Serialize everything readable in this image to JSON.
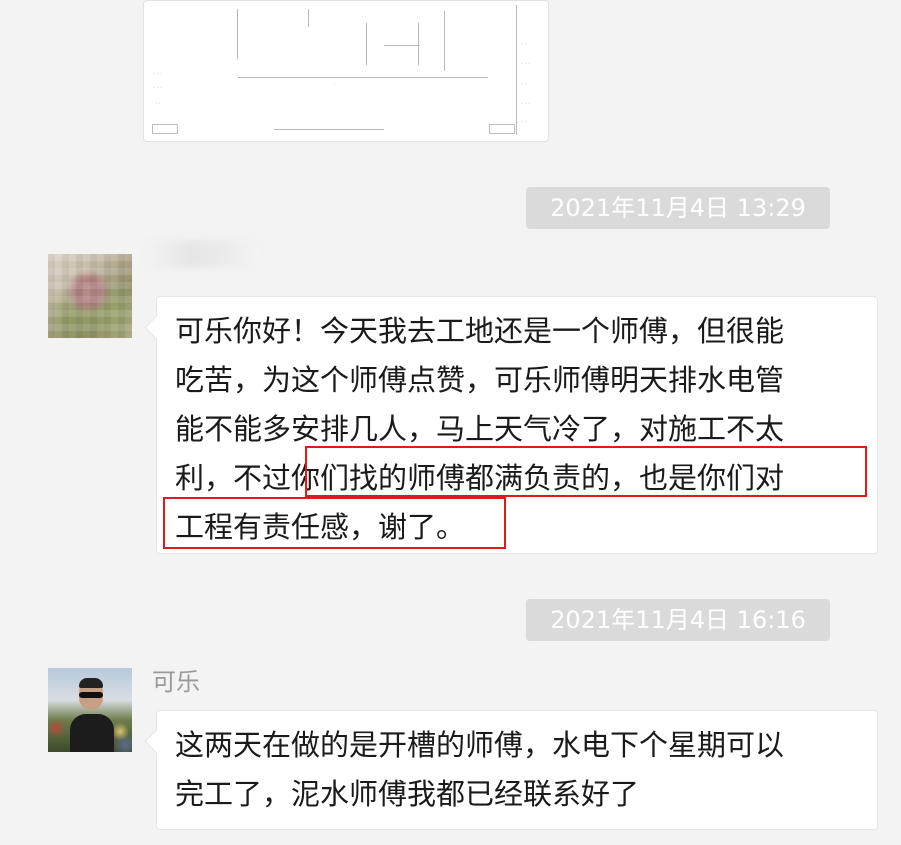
{
  "messages": [
    {
      "timestamp": "2021年11月4日 13:29",
      "lines": [
        "可乐你好！今天我去工地还是一个师傅，但很能",
        "吃苦，为这个师傅点赞，可乐师傅明天排水电管",
        "能不能多安排几人，马上天气冷了，对施工不太",
        "利，不过你们找的师傅都满负责的，也是你们对",
        "工程有责任感，谢了。"
      ]
    },
    {
      "timestamp": "2021年11月4日 16:16",
      "sender": "可乐",
      "lines": [
        "这两天在做的是开槽的师傅，水电下个星期可以",
        "完工了，泥水师傅我都已经联系好了"
      ]
    }
  ],
  "colors": {
    "background": "#f3f3f3",
    "bubble": "#ffffff",
    "timestamp_bg": "#dadada",
    "timestamp_text": "#ffffff",
    "annotation": "#e0191b"
  }
}
